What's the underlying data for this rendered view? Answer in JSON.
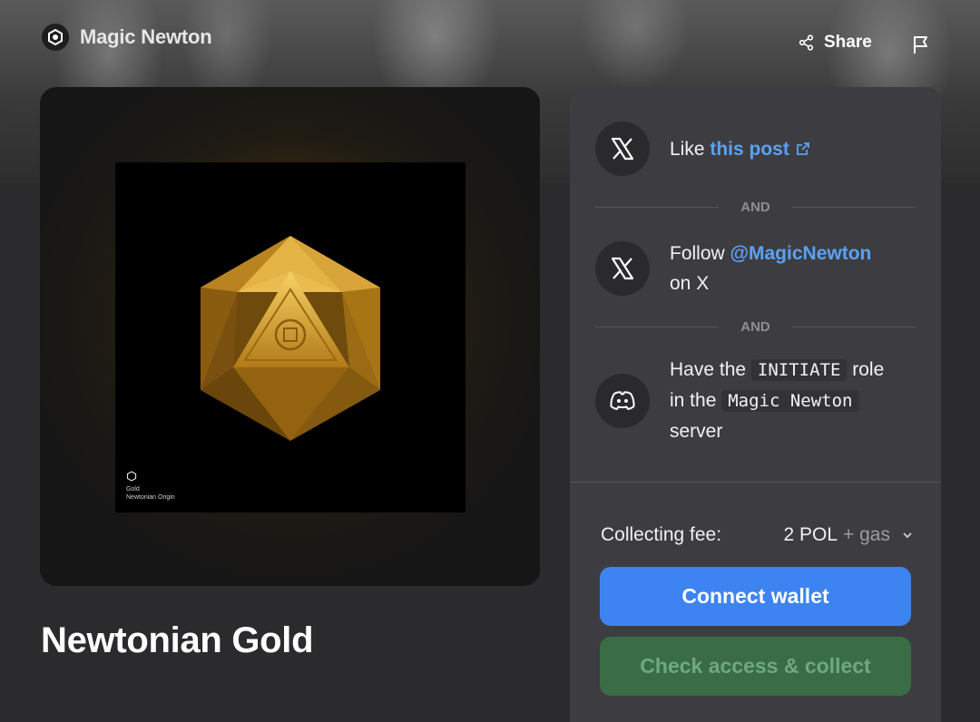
{
  "header": {
    "brand_name": "Magic Newton",
    "share_label": "Share"
  },
  "artwork": {
    "caption_line1": "Gold",
    "caption_line2": "Newtonian Origin"
  },
  "title": "Newtonian Gold",
  "requirements": [
    {
      "prefix": "Like ",
      "link": "this post"
    },
    {
      "prefix": "Follow ",
      "link": "@MagicNewton",
      "suffix": "on X"
    },
    {
      "line1_pre": "Have the ",
      "role": "INITIATE",
      "line1_post": " role",
      "line2_pre": "in the ",
      "server": "Magic Newton",
      "line3": "server"
    }
  ],
  "connector": "AND",
  "fee": {
    "label": "Collecting fee:",
    "amount": "2 POL",
    "gas": "+ gas"
  },
  "buttons": {
    "connect": "Connect wallet",
    "collect": "Check access & collect"
  },
  "colors": {
    "primary_button": "#3d84f2",
    "disabled_button": "#3a6c46",
    "link": "#5aa2f5",
    "panel": "#3d3d41"
  },
  "icons": [
    "magic-newton-logo",
    "share-icon",
    "flag-icon",
    "x-logo-icon",
    "external-link-icon",
    "discord-icon",
    "chevron-down-icon"
  ]
}
